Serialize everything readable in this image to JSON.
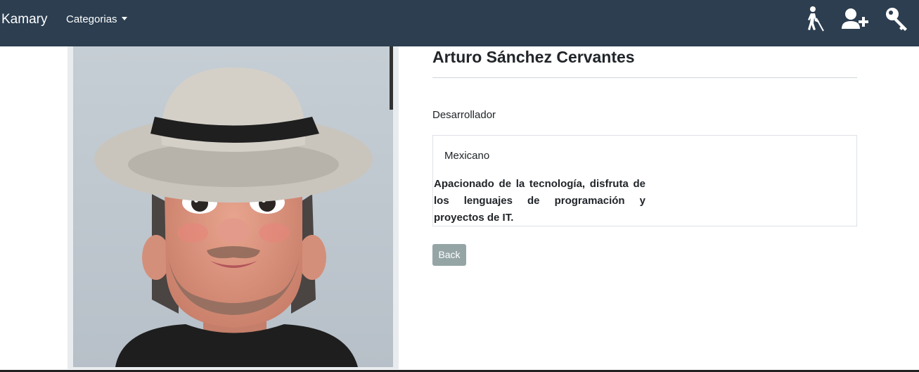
{
  "navbar": {
    "brand": "Kamary",
    "categories_label": "Categorias",
    "icons": [
      "accessibility-cane-icon",
      "add-user-icon",
      "key-icon"
    ]
  },
  "profile": {
    "name": "Arturo Sánchez Cervantes",
    "role": "Desarrollador",
    "nationality": "Mexicano",
    "bio": "Apacionado de la tecnología, disfruta de los lenguajes de programación y proyectos de IT."
  },
  "actions": {
    "back_label": "Back"
  },
  "colors": {
    "navbar": "#2c3e50",
    "button": "#95a5a6"
  }
}
